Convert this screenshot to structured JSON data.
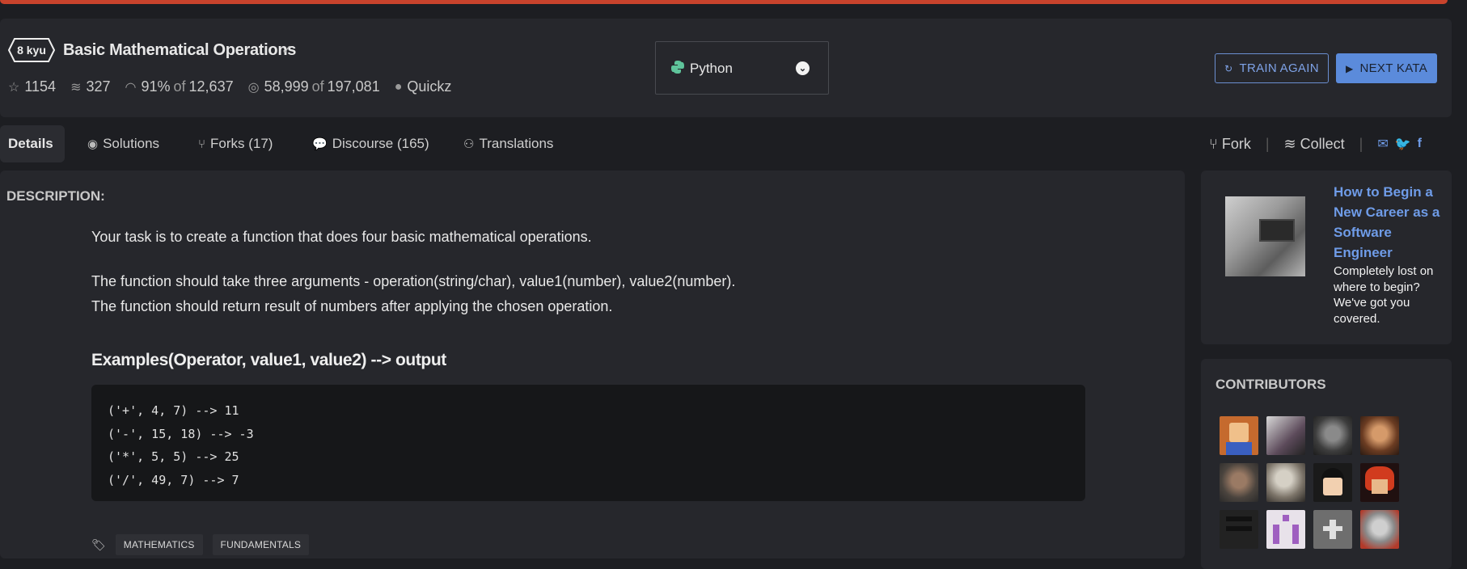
{
  "kata": {
    "rank": "8 kyu",
    "title": "Basic Mathematical Operations",
    "stars": "1154",
    "collections": "327",
    "satisfaction_pct": "91%",
    "satisfaction_of_label": "of",
    "satisfaction_votes": "12,637",
    "completed": "58,999",
    "attempts_of_label": "of",
    "attempts": "197,081",
    "author": "Quickz"
  },
  "language": {
    "name": "Python"
  },
  "actions": {
    "train_again": "TRAIN AGAIN",
    "next_kata": "NEXT KATA"
  },
  "tabs": [
    {
      "label": "Details"
    },
    {
      "label": "Solutions"
    },
    {
      "label": "Forks (17)"
    },
    {
      "label": "Discourse (165)"
    },
    {
      "label": "Translations"
    }
  ],
  "right_actions": {
    "fork": "Fork",
    "collect": "Collect"
  },
  "description": {
    "label": "DESCRIPTION:",
    "p1": "Your task is to create a function that does four basic mathematical operations.",
    "p2": "The function should take three arguments - operation(string/char), value1(number), value2(number).",
    "p3": "The function should return result of numbers after applying the chosen operation.",
    "examples_heading": "Examples(Operator, value1, value2) --> output",
    "code_lines": [
      "('+', 4, 7) --> 11",
      "('-', 15, 18) --> -3",
      "('*', 5, 5) --> 25",
      "('/', 49, 7) --> 7"
    ],
    "tags": [
      "MATHEMATICS",
      "FUNDAMENTALS"
    ]
  },
  "ad": {
    "title": "How to Begin a New Career as a Software Engineer",
    "text": "Completely lost on where to begin? We've got you covered."
  },
  "contributors": {
    "label": "CONTRIBUTORS",
    "count": 12
  },
  "colors": {
    "accent": "#5b8bdb",
    "topbar": "#c8432c",
    "background": "#1d1e22",
    "panel": "#26272c"
  }
}
